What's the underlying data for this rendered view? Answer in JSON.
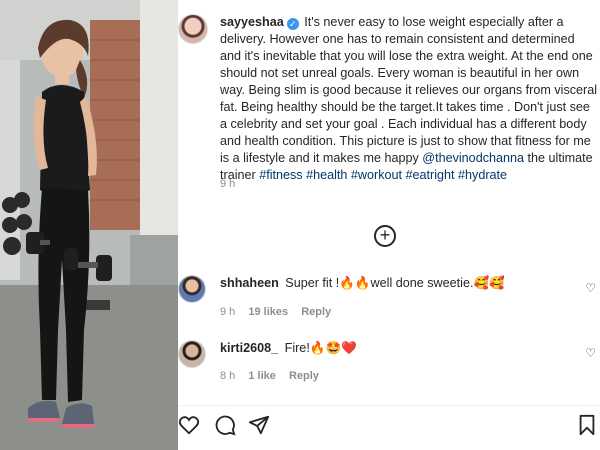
{
  "post": {
    "username": "sayyeshaa",
    "caption": "It's never easy to lose weight especially after a delivery. However one has to remain consistent and determined and it's inevitable that you will lose the extra weight. At the end one should not set unreal goals. Every woman is beautiful in her own way. Being slim is good because it relieves our organs from visceral fat. Being healthy should be the target.It takes time . Don't just see a celebrity and set your goal . Each individual has a different body and health condition. This picture is just to show that fitness for me is a lifestyle and it makes me happy",
    "mention": "@thevinodchanna",
    "caption_tail": "the ultimate trainer",
    "hashtags": "#fitness #health #workout #eatright #hydrate",
    "time": "9 h",
    "more_label": "+"
  },
  "comments": [
    {
      "username": "shhaheen",
      "text": "Super fit !🔥🔥well done sweetie.🥰🥰",
      "time": "9 h",
      "likes": "19 likes",
      "reply": "Reply"
    },
    {
      "username": "kirti2608_",
      "text": "Fire!🔥🤩❤️",
      "time": "8 h",
      "likes": "1 like",
      "reply": "Reply"
    }
  ],
  "icons": {
    "verified": "verified-badge-icon",
    "like": "heart-icon",
    "comment": "comment-icon",
    "share": "share-icon",
    "save": "bookmark-icon",
    "more": "plus-circle-icon"
  },
  "colors": {
    "text": "#262626",
    "secondary": "#8e8e8e",
    "link": "#00376b",
    "verified": "#3897f0"
  }
}
